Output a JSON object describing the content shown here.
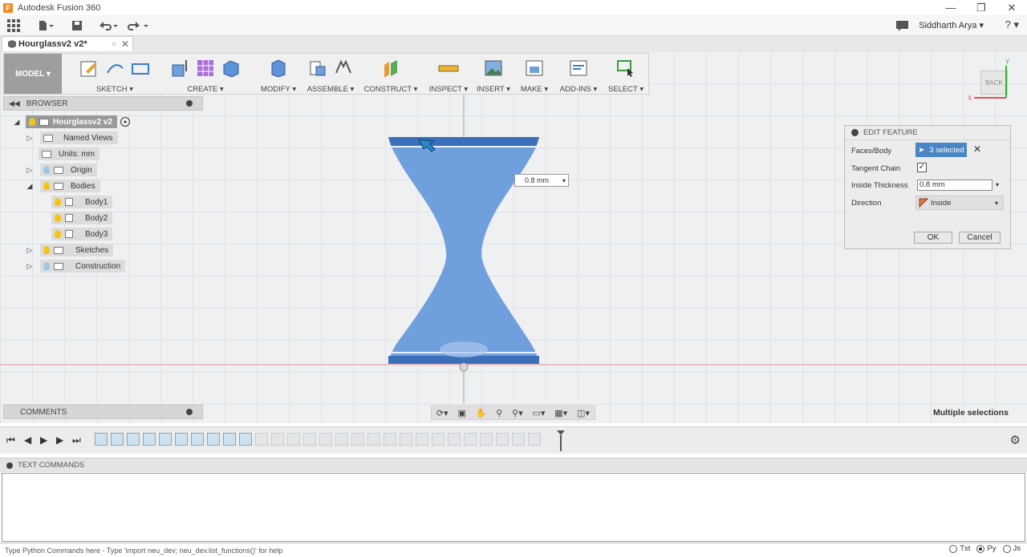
{
  "window": {
    "title": "Autodesk Fusion 360",
    "app_logo": "F"
  },
  "menubar": {
    "user": "Siddharth Arya ▾",
    "help": "? ▾"
  },
  "tab": {
    "label": "Hourglassv2 v2*"
  },
  "toolbar": {
    "mode": "MODEL ▾",
    "groups": [
      {
        "label": "SKETCH ▾"
      },
      {
        "label": "CREATE ▾"
      },
      {
        "label": "MODIFY ▾"
      },
      {
        "label": "ASSEMBLE ▾"
      },
      {
        "label": "CONSTRUCT ▾"
      },
      {
        "label": "INSPECT ▾"
      },
      {
        "label": "INSERT ▾"
      },
      {
        "label": "MAKE ▾"
      },
      {
        "label": "ADD-INS ▾"
      },
      {
        "label": "SELECT ▾"
      }
    ]
  },
  "browser": {
    "title": "BROWSER",
    "root": "Hourglassv2 v2",
    "items": [
      {
        "label": "Named Views"
      },
      {
        "label": "Units: mm"
      },
      {
        "label": "Origin"
      },
      {
        "label": "Bodies"
      },
      {
        "label": "Body1"
      },
      {
        "label": "Body2"
      },
      {
        "label": "Body3"
      },
      {
        "label": "Sketches"
      },
      {
        "label": "Construction"
      }
    ]
  },
  "comments": {
    "title": "COMMENTS"
  },
  "viewcube": {
    "face": "BACK",
    "x": "X",
    "y": "Y"
  },
  "canvas": {
    "thickness_value": "0.8 mm"
  },
  "edit_feature": {
    "title": "EDIT FEATURE",
    "faces_label": "Faces/Body",
    "faces_value": "3 selected",
    "tangent_label": "Tangent Chain",
    "thickness_label": "Inside Thickness",
    "thickness_value": "0.8 mm",
    "direction_label": "Direction",
    "direction_value": "Inside",
    "ok": "OK",
    "cancel": "Cancel"
  },
  "status_hint": "Multiple selections",
  "text_commands": {
    "title": "TEXT COMMANDS",
    "placeholder": "Type Python Commands here - Type 'import neu_dev; neu_dev.list_functions()' for help",
    "modes": [
      "Txt",
      "Py",
      "Js"
    ],
    "selected_mode": "Py"
  },
  "colors": {
    "accent": "#4a86c5",
    "body": "#6f9fdc",
    "axis_red": "#e05050",
    "axis_green": "#38b038"
  }
}
